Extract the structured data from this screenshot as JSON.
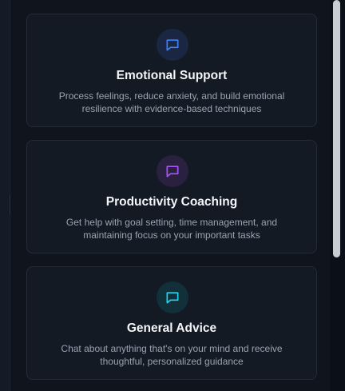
{
  "cards": [
    {
      "title": "Emotional Support",
      "description": "Process feelings, reduce anxiety, and build emotional resilience with evidence-based techniques",
      "icon": "chat-bubble-icon",
      "accent": "#3b82f6",
      "icon_bg": "#1b2742"
    },
    {
      "title": "Productivity Coaching",
      "description": "Get help with goal setting, time management, and maintaining focus on your important tasks",
      "icon": "chat-bubble-icon",
      "accent": "#a855f7",
      "icon_bg": "#2a2140"
    },
    {
      "title": "General Advice",
      "description": "Chat about anything that's on your mind and receive thoughtful, personalized guidance",
      "icon": "chat-bubble-icon",
      "accent": "#22d3ee",
      "icon_bg": "#12303a"
    }
  ]
}
